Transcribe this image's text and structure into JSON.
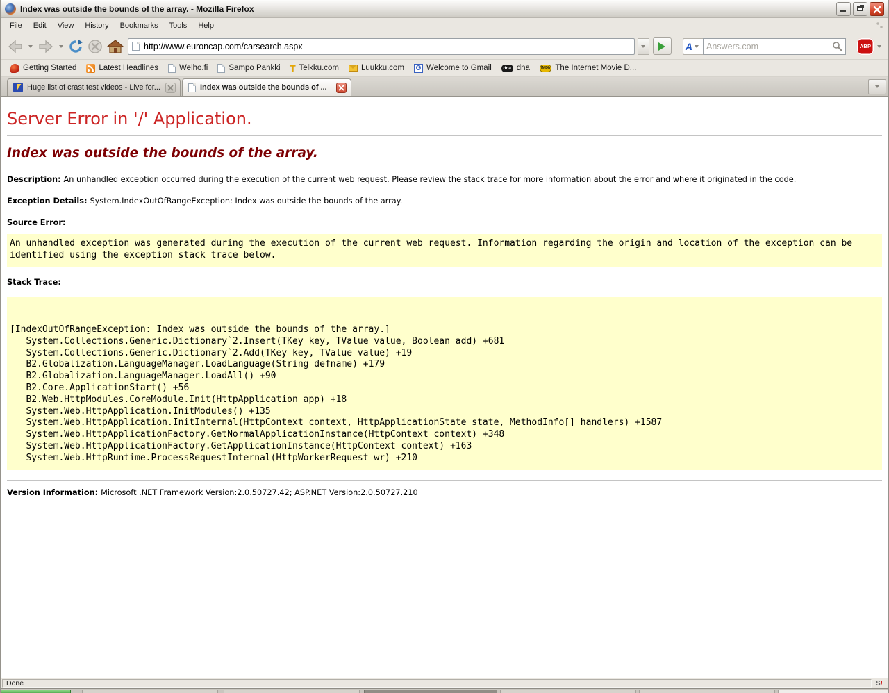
{
  "window": {
    "title": "Index was outside the bounds of the array. - Mozilla Firefox"
  },
  "menubar": {
    "items": [
      {
        "label": "File"
      },
      {
        "label": "Edit"
      },
      {
        "label": "View"
      },
      {
        "label": "History"
      },
      {
        "label": "Bookmarks"
      },
      {
        "label": "Tools"
      },
      {
        "label": "Help"
      }
    ]
  },
  "navbar": {
    "url": "http://www.euroncap.com/carsearch.aspx",
    "search_placeholder": "Answers.com",
    "adblock_label": "ABP"
  },
  "bookmarks": {
    "items": [
      {
        "label": "Getting Started",
        "icon": "firefox-bookmark-icon"
      },
      {
        "label": "Latest Headlines",
        "icon": "rss-icon"
      },
      {
        "label": "Welho.fi",
        "icon": "page-icon"
      },
      {
        "label": "Sampo Pankki",
        "icon": "page-icon"
      },
      {
        "label": "Telkku.com",
        "icon": "telkku-icon"
      },
      {
        "label": "Luukku.com",
        "icon": "envelope-icon"
      },
      {
        "label": "Welcome to Gmail",
        "icon": "gmail-icon"
      },
      {
        "label": "dna",
        "icon": "dna-icon",
        "badge": "dna"
      },
      {
        "label": "The Internet Movie D...",
        "icon": "imdb-icon",
        "badge": "IMDb"
      }
    ]
  },
  "tabs": [
    {
      "label": "Huge list of crast test videos - Live for...",
      "active": false
    },
    {
      "label": "Index was outside the bounds of ...",
      "active": true
    }
  ],
  "page": {
    "h1": "Server Error in '/' Application.",
    "h2": "Index was outside the bounds of the array.",
    "description_label": "Description: ",
    "description_text": "An unhandled exception occurred during the execution of the current web request. Please review the stack trace for more information about the error and where it originated in the code.",
    "exception_label": "Exception Details: ",
    "exception_text": "System.IndexOutOfRangeException: Index was outside the bounds of the array.",
    "source_error_label": "Source Error:",
    "source_error_text": "An unhandled exception was generated during the execution of the current web request. Information regarding the origin and location of the exception can be identified using the exception stack trace below.",
    "stack_trace_label": "Stack Trace:",
    "stack_trace_text": "\n\n[IndexOutOfRangeException: Index was outside the bounds of the array.]\n   System.Collections.Generic.Dictionary`2.Insert(TKey key, TValue value, Boolean add) +681\n   System.Collections.Generic.Dictionary`2.Add(TKey key, TValue value) +19\n   B2.Globalization.LanguageManager.LoadLanguage(String defname) +179\n   B2.Globalization.LanguageManager.LoadAll() +90\n   B2.Core.ApplicationStart() +56\n   B2.Web.HttpModules.CoreModule.Init(HttpApplication app) +18\n   System.Web.HttpApplication.InitModules() +135\n   System.Web.HttpApplication.InitInternal(HttpContext context, HttpApplicationState state, MethodInfo[] handlers) +1587\n   System.Web.HttpApplicationFactory.GetNormalApplicationInstance(HttpContext context) +348\n   System.Web.HttpApplicationFactory.GetApplicationInstance(HttpContext context) +163\n   System.Web.HttpRuntime.ProcessRequestInternal(HttpWorkerRequest wr) +210\n",
    "version_label": "Version Information: ",
    "version_text": "Microsoft .NET Framework Version:2.0.50727.42; ASP.NET Version:2.0.50727.210"
  },
  "statusbar": {
    "text": "Done",
    "ext_s": "S",
    "ext_bang": "!"
  },
  "colors": {
    "error_heading": "#cc2424",
    "error_subheading": "#7d0003",
    "code_background": "#ffffcc",
    "chrome_silver": "#eae7e1",
    "adblock_red": "#cc1111",
    "start_button_green": "#3f9c3f"
  }
}
